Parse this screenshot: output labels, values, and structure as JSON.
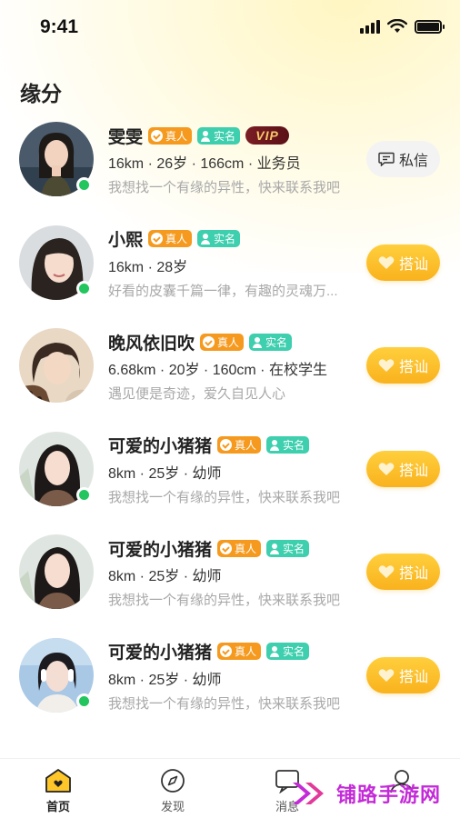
{
  "status_bar": {
    "time": "9:41"
  },
  "page": {
    "title": "缘分"
  },
  "users": [
    {
      "name": "雯雯",
      "badges": [
        "真人",
        "实名"
      ],
      "vip": "VIP",
      "meta": "16km · 26岁 · 166cm · 业务员",
      "bio": "我想找一个有缘的异性，快来联系我吧",
      "online": true,
      "action": "私信",
      "action_type": "chat"
    },
    {
      "name": "小熙",
      "badges": [
        "真人",
        "实名"
      ],
      "vip": null,
      "meta": "16km · 28岁",
      "bio": "好看的皮囊千篇一律，有趣的灵魂万...",
      "online": true,
      "action": "搭讪",
      "action_type": "accost"
    },
    {
      "name": "晚风依旧吹",
      "badges": [
        "真人",
        "实名"
      ],
      "vip": null,
      "meta": "6.68km · 20岁 · 160cm · 在校学生",
      "bio": "遇见便是奇迹，爱久自见人心",
      "online": false,
      "action": "搭讪",
      "action_type": "accost"
    },
    {
      "name": "可爱的小猪猪",
      "badges": [
        "真人",
        "实名"
      ],
      "vip": null,
      "meta": "8km · 25岁 · 幼师",
      "bio": "我想找一个有缘的异性，快来联系我吧",
      "online": true,
      "action": "搭讪",
      "action_type": "accost"
    },
    {
      "name": "可爱的小猪猪",
      "badges": [
        "真人",
        "实名"
      ],
      "vip": null,
      "meta": "8km · 25岁 · 幼师",
      "bio": "我想找一个有缘的异性，快来联系我吧",
      "online": false,
      "action": "搭讪",
      "action_type": "accost"
    },
    {
      "name": "可爱的小猪猪",
      "badges": [
        "真人",
        "实名"
      ],
      "vip": null,
      "meta": "8km · 25岁 · 幼师",
      "bio": "我想找一个有缘的异性，快来联系我吧",
      "online": true,
      "action": "搭讪",
      "action_type": "accost"
    }
  ],
  "tabbar": {
    "items": [
      {
        "label": "首页",
        "icon": "home-icon",
        "active": true
      },
      {
        "label": "发现",
        "icon": "compass-icon",
        "active": false
      },
      {
        "label": "消息",
        "icon": "message-icon",
        "active": false
      }
    ]
  },
  "watermark": {
    "text": "铺路手游网"
  },
  "colors": {
    "accent": "#f9b21d",
    "real_badge": "#f59a1f",
    "name_badge": "#3ecfae",
    "online": "#22c55e",
    "vip_bg": "#7a1d24",
    "watermark": "#c42bd8"
  }
}
